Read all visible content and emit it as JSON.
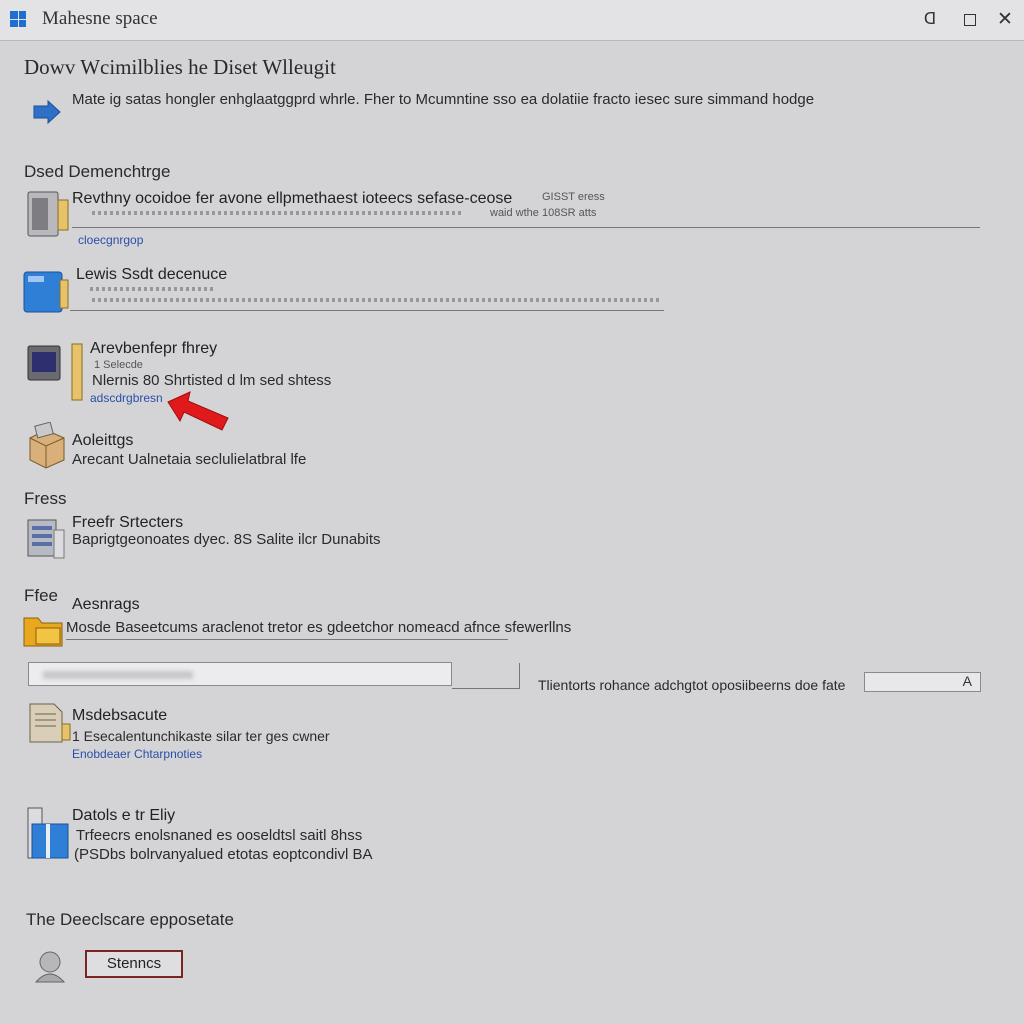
{
  "window": {
    "title": "Mahesne space",
    "minimize_glyph": "ᗡ",
    "close_glyph": "✕"
  },
  "main": {
    "heading": "Dowv Wcimilblies he Diset Wlleugit",
    "intro": "Mate ig satas hongler enhglaatggprd whrle. Fher to Mcumntine sso ea dolatiie fracto iesec sure simmand hodge"
  },
  "sections": {
    "s1": {
      "label": "Dsed Demenchtrge"
    },
    "s2": {
      "label": "Fress"
    },
    "s3": {
      "label": "Ffee"
    },
    "s4": {
      "label": "The Deeclscare epposetate"
    }
  },
  "items": {
    "i1": {
      "title": "Revthny ocoidoe fer avone ellpmethaest ioteecs sefase-ceose",
      "side_top": "GISST eress",
      "side_bottom": "waid wthe 108SR atts",
      "link": "cloecgnrgop"
    },
    "i2": {
      "title": "Lewis Ssdt decenuce"
    },
    "i3": {
      "title": "Arevbenfepr fhrey",
      "sub": "1 Selecde",
      "desc": "Nlernis 80 Shrtisted d lm sed shtess",
      "link": "adscdrgbresn"
    },
    "i4": {
      "title": "Aoleittgs",
      "desc": "Arecant Ualnetaia seclulielatbral lfe"
    },
    "i5": {
      "title": "Freefr Srtecters",
      "desc": "Baprigtgeonoates dyec. 8S Salite ilcr Dunabits"
    },
    "i6": {
      "title": "Aesnrags",
      "desc": "Mosde Baseetcums araclenot tretor es gdeetchor nomeacd afnce sfewerllns"
    },
    "field_row": {
      "label": "Tlientorts rohance adchgtot oposiibeerns doe fate",
      "combo_arrow": "A"
    },
    "i7": {
      "title": "Msdebsacute",
      "desc": "1 Esecalentunchikaste silar ter ges cwner",
      "link": "Enobdeaer Chtarpnoties"
    },
    "i8": {
      "title": "Datols e tr Eliy",
      "line1": "Trfeecrs enolsnaned es ooseldtsl saitl 8hss",
      "line2": "(PSDbs bolrvanyalued etotas eoptcondivl BA"
    }
  },
  "footer": {
    "button_label": "Stenncs"
  },
  "colors": {
    "background": "#d4d4d6",
    "accent_blue": "#1f6fd1",
    "link_blue": "#2a4fa8",
    "arrow_red": "#e01a1a",
    "button_border": "#7a2424"
  }
}
